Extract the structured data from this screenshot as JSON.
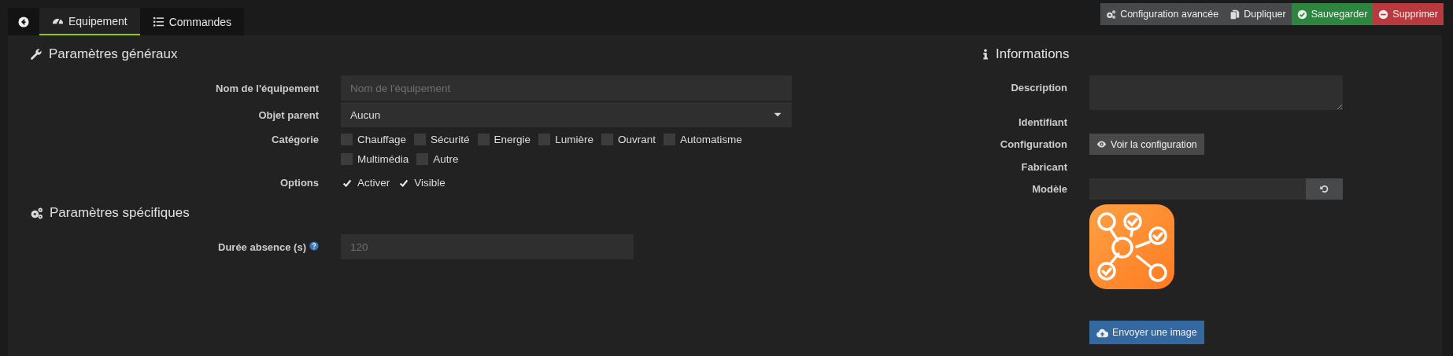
{
  "tabs": [
    {
      "label": "Equipement",
      "selected": true
    },
    {
      "label": "Commandes",
      "selected": false
    }
  ],
  "actions": [
    {
      "label": "Configuration avancée",
      "kind": "default"
    },
    {
      "label": "Dupliquer",
      "kind": "default"
    },
    {
      "label": "Sauvegarder",
      "kind": "success"
    },
    {
      "label": "Supprimer",
      "kind": "danger"
    }
  ],
  "general": {
    "title": "Paramètres généraux",
    "fields": [
      {
        "kind": "text",
        "label": "Nom de l'équipement",
        "placeholder": "Nom de l'équipement"
      },
      {
        "kind": "select",
        "label": "Objet parent",
        "value": "Aucun"
      },
      {
        "kind": "checkboxes",
        "label": "Catégorie",
        "options": [
          {
            "label": "Chauffage",
            "checked": false
          },
          {
            "label": "Sécurité",
            "checked": false
          },
          {
            "label": "Energie",
            "checked": false
          },
          {
            "label": "Lumière",
            "checked": false
          },
          {
            "label": "Ouvrant",
            "checked": false
          },
          {
            "label": "Automatisme",
            "checked": false
          },
          {
            "label": "Multimédia",
            "checked": false
          },
          {
            "label": "Autre",
            "checked": false
          }
        ]
      },
      {
        "kind": "checkboxes",
        "label": "Options",
        "options": [
          {
            "label": "Activer",
            "checked": true
          },
          {
            "label": "Visible",
            "checked": true
          }
        ]
      }
    ]
  },
  "specific": {
    "title": "Paramètres spécifiques",
    "fields": [
      {
        "kind": "text",
        "label": "Durée absence (s)",
        "help": true,
        "placeholder": "120"
      }
    ]
  },
  "informations": {
    "title": "Informations",
    "fields": [
      {
        "kind": "textarea",
        "label": "Description"
      },
      {
        "kind": "static",
        "label": "Identifiant"
      },
      {
        "kind": "button",
        "label": "Configuration",
        "button": "Voir la configuration"
      },
      {
        "kind": "static",
        "label": "Fabricant"
      },
      {
        "kind": "reset-input",
        "label": "Modèle"
      }
    ],
    "upload_button": "Envoyer une image"
  }
}
